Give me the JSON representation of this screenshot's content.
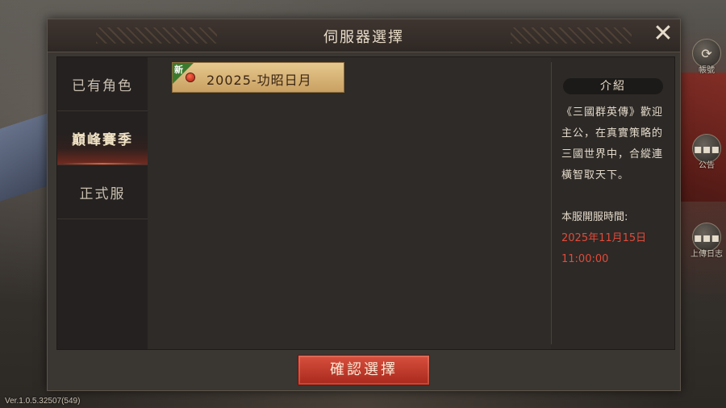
{
  "dialog": {
    "title": "伺服器選擇",
    "close_icon": "close-icon",
    "confirm_label": "確認選擇"
  },
  "nav": {
    "items": [
      {
        "label": "已有角色",
        "active": false
      },
      {
        "label": "巔峰賽季",
        "active": true
      },
      {
        "label": "正式服",
        "active": false
      }
    ]
  },
  "servers": [
    {
      "badge": "新",
      "name": "20025-功昭日月",
      "status_color": "#d8281c"
    }
  ],
  "intro": {
    "heading": "介紹",
    "body": "《三國群英傳》歡迎主公，在真實策略的三國世界中，合縱連橫智取天下。",
    "open_time_label": "本服開服時間:",
    "open_time_date": "2025年11月15日",
    "open_time_clock": "11:00:00"
  },
  "side_buttons": [
    {
      "icon": "refresh-icon",
      "label": "帳號"
    },
    {
      "icon": "chat-icon",
      "label": "公告"
    },
    {
      "icon": "chat-icon",
      "label": "上傳日志"
    }
  ],
  "version": "Ver.1.0.5.32507(549)",
  "colors": {
    "accent_red": "#e24a3a",
    "card_gold": "#e6c88e",
    "new_badge_green": "#3b7a2e"
  }
}
